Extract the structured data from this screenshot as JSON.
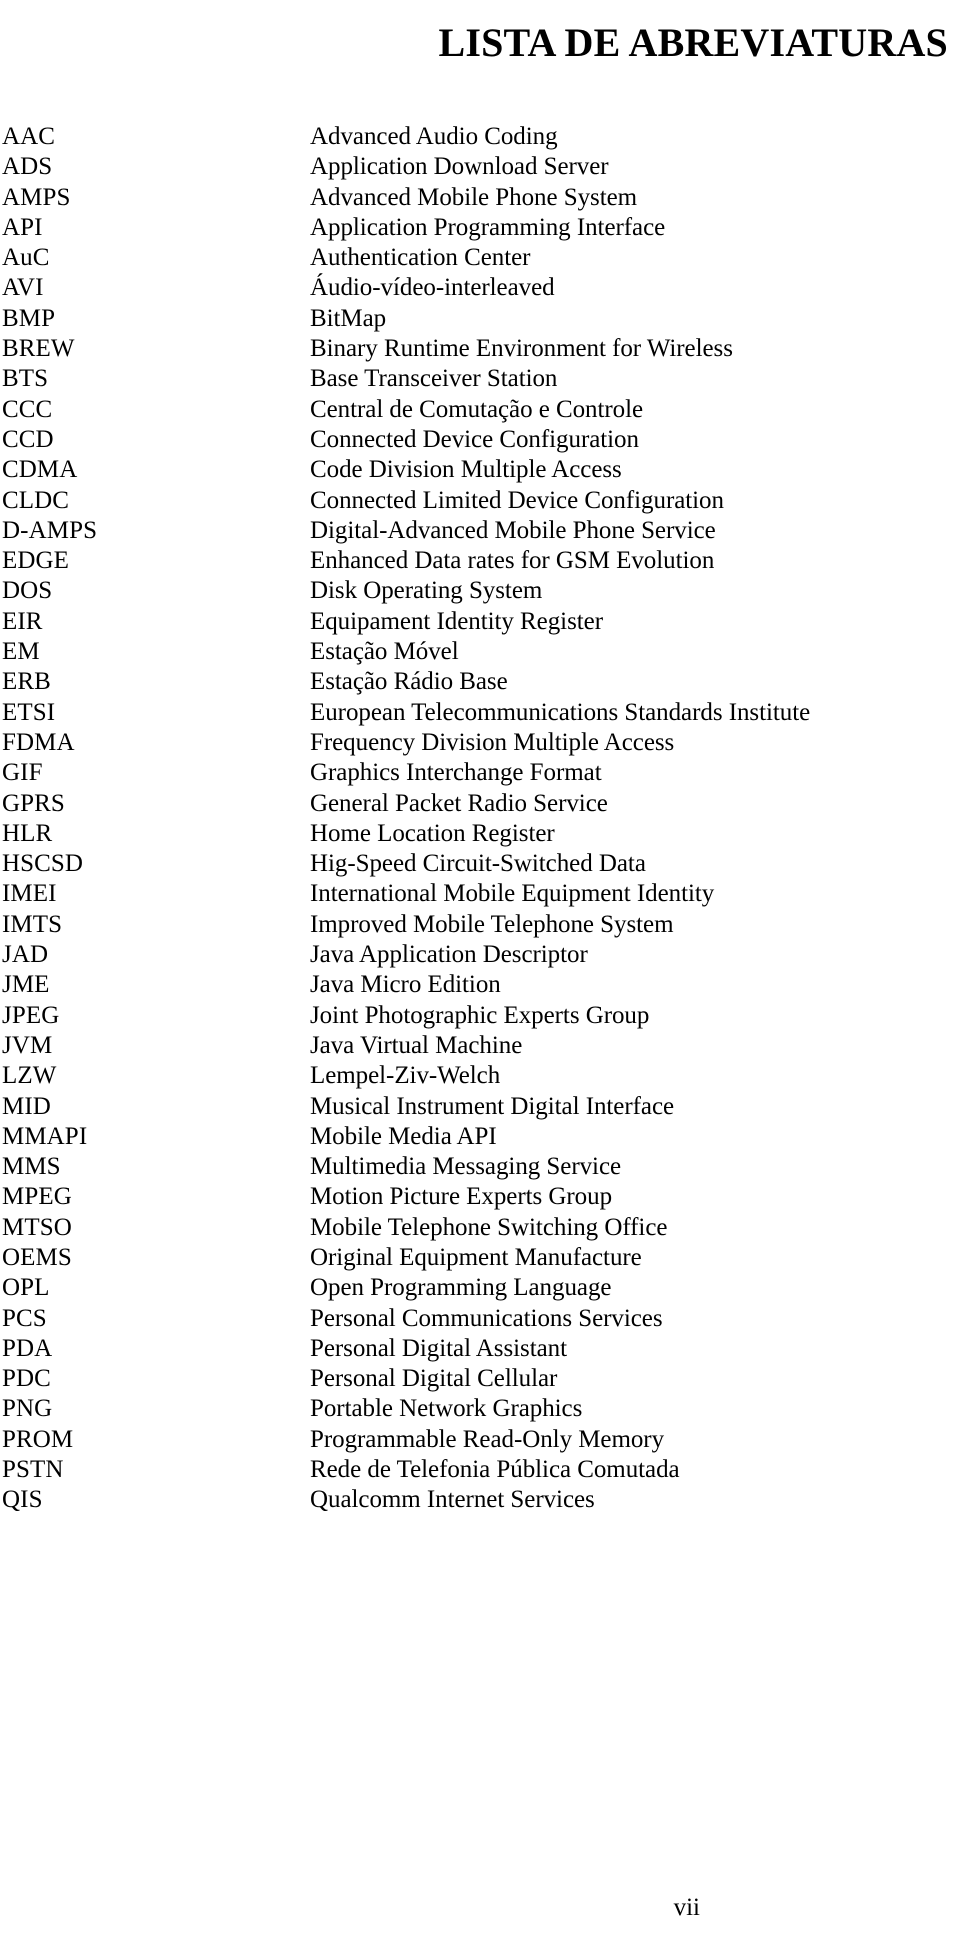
{
  "document": {
    "title": "LISTA DE ABREVIATURAS",
    "page_number": "vii",
    "language": "pt-BR"
  },
  "abbreviations": [
    {
      "term": "AAC",
      "definition": "Advanced Audio Coding"
    },
    {
      "term": "ADS",
      "definition": "Application Download Server"
    },
    {
      "term": "AMPS",
      "definition": "Advanced Mobile Phone System"
    },
    {
      "term": "API",
      "definition": "Application Programming Interface"
    },
    {
      "term": "AuC",
      "definition": "Authentication Center"
    },
    {
      "term": "AVI",
      "definition": "Áudio-vídeo-interleaved"
    },
    {
      "term": "BMP",
      "definition": "BitMap"
    },
    {
      "term": "BREW",
      "definition": "Binary Runtime Environment for Wireless"
    },
    {
      "term": "BTS",
      "definition": "Base Transceiver Station"
    },
    {
      "term": "CCC",
      "definition": "Central de Comutação e Controle"
    },
    {
      "term": "CCD",
      "definition": "Connected Device Configuration"
    },
    {
      "term": "CDMA",
      "definition": "Code Division Multiple Access"
    },
    {
      "term": "CLDC",
      "definition": "Connected Limited Device Configuration"
    },
    {
      "term": "D-AMPS",
      "definition": "Digital-Advanced Mobile Phone Service"
    },
    {
      "term": "EDGE",
      "definition": "Enhanced Data rates for GSM Evolution"
    },
    {
      "term": "DOS",
      "definition": "Disk Operating System"
    },
    {
      "term": "EIR",
      "definition": "Equipament Identity Register"
    },
    {
      "term": "EM",
      "definition": "Estação Móvel"
    },
    {
      "term": "ERB",
      "definition": "Estação Rádio Base"
    },
    {
      "term": "ETSI",
      "definition": "European Telecommunications Standards Institute"
    },
    {
      "term": "FDMA",
      "definition": "Frequency Division Multiple Access"
    },
    {
      "term": "GIF",
      "definition": "Graphics Interchange Format"
    },
    {
      "term": "GPRS",
      "definition": "General Packet Radio Service"
    },
    {
      "term": "HLR",
      "definition": "Home Location Register"
    },
    {
      "term": "HSCSD",
      "definition": "Hig-Speed Circuit-Switched Data"
    },
    {
      "term": "IMEI",
      "definition": "International Mobile Equipment Identity"
    },
    {
      "term": "IMTS",
      "definition": "Improved Mobile Telephone System"
    },
    {
      "term": "JAD",
      "definition": "Java Application Descriptor"
    },
    {
      "term": "JME",
      "definition": "Java Micro Edition"
    },
    {
      "term": "JPEG",
      "definition": "Joint Photographic Experts Group"
    },
    {
      "term": "JVM",
      "definition": "Java Virtual Machine"
    },
    {
      "term": "LZW",
      "definition": "Lempel-Ziv-Welch"
    },
    {
      "term": "MID",
      "definition": "Musical Instrument Digital Interface"
    },
    {
      "term": "MMAPI",
      "definition": "Mobile Media API"
    },
    {
      "term": "MMS",
      "definition": "Multimedia Messaging Service"
    },
    {
      "term": "MPEG",
      "definition": "Motion Picture Experts Group"
    },
    {
      "term": "MTSO",
      "definition": "Mobile Telephone Switching Office"
    },
    {
      "term": "OEMS",
      "definition": "Original Equipment Manufacture"
    },
    {
      "term": "OPL",
      "definition": "Open Programming Language"
    },
    {
      "term": "PCS",
      "definition": "Personal Communications Services"
    },
    {
      "term": "PDA",
      "definition": "Personal Digital Assistant"
    },
    {
      "term": "PDC",
      "definition": "Personal Digital Cellular"
    },
    {
      "term": "PNG",
      "definition": "Portable Network Graphics"
    },
    {
      "term": "PROM",
      "definition": "Programmable Read-Only Memory"
    },
    {
      "term": "PSTN",
      "definition": "Rede de Telefonia Pública Comutada"
    },
    {
      "term": "QIS",
      "definition": "Qualcomm Internet Services"
    }
  ]
}
